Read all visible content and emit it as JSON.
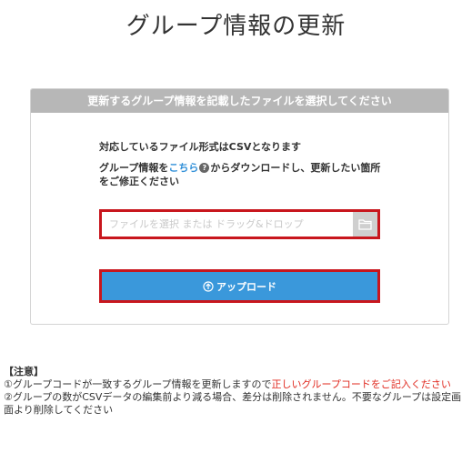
{
  "page": {
    "title": "グループ情報の更新"
  },
  "panel": {
    "header": "更新するグループ情報を記載したファイルを選択してください",
    "formats_text": "対応しているファイル形式はCSVとなります",
    "download_prefix": "グループ情報を",
    "download_link": "こちら",
    "help_icon": "question-icon",
    "download_suffix": "からダウンロードし、更新したい箇所をご修正ください",
    "file_placeholder": "ファイルを選択 または ドラッグ&ドロップ",
    "folder_icon": "folder-icon",
    "upload_icon": "circle-up-arrow-icon",
    "upload_label": "アップロード"
  },
  "notes": {
    "heading": "【注意】",
    "note1_prefix": "①グループコードが一致するグループ情報を更新しますので",
    "note1_highlight": "正しいグループコードをご記入ください",
    "note2": "②グループの数がCSVデータの編集前より減る場合、差分は削除されません。不要なグループは設定画面より削除してください"
  },
  "colors": {
    "header_bg": "#b7b7b7",
    "link": "#2f8fd8",
    "upload_bg": "#3a98db",
    "highlight_border": "#c8161d",
    "warning_text": "#e0281e"
  }
}
